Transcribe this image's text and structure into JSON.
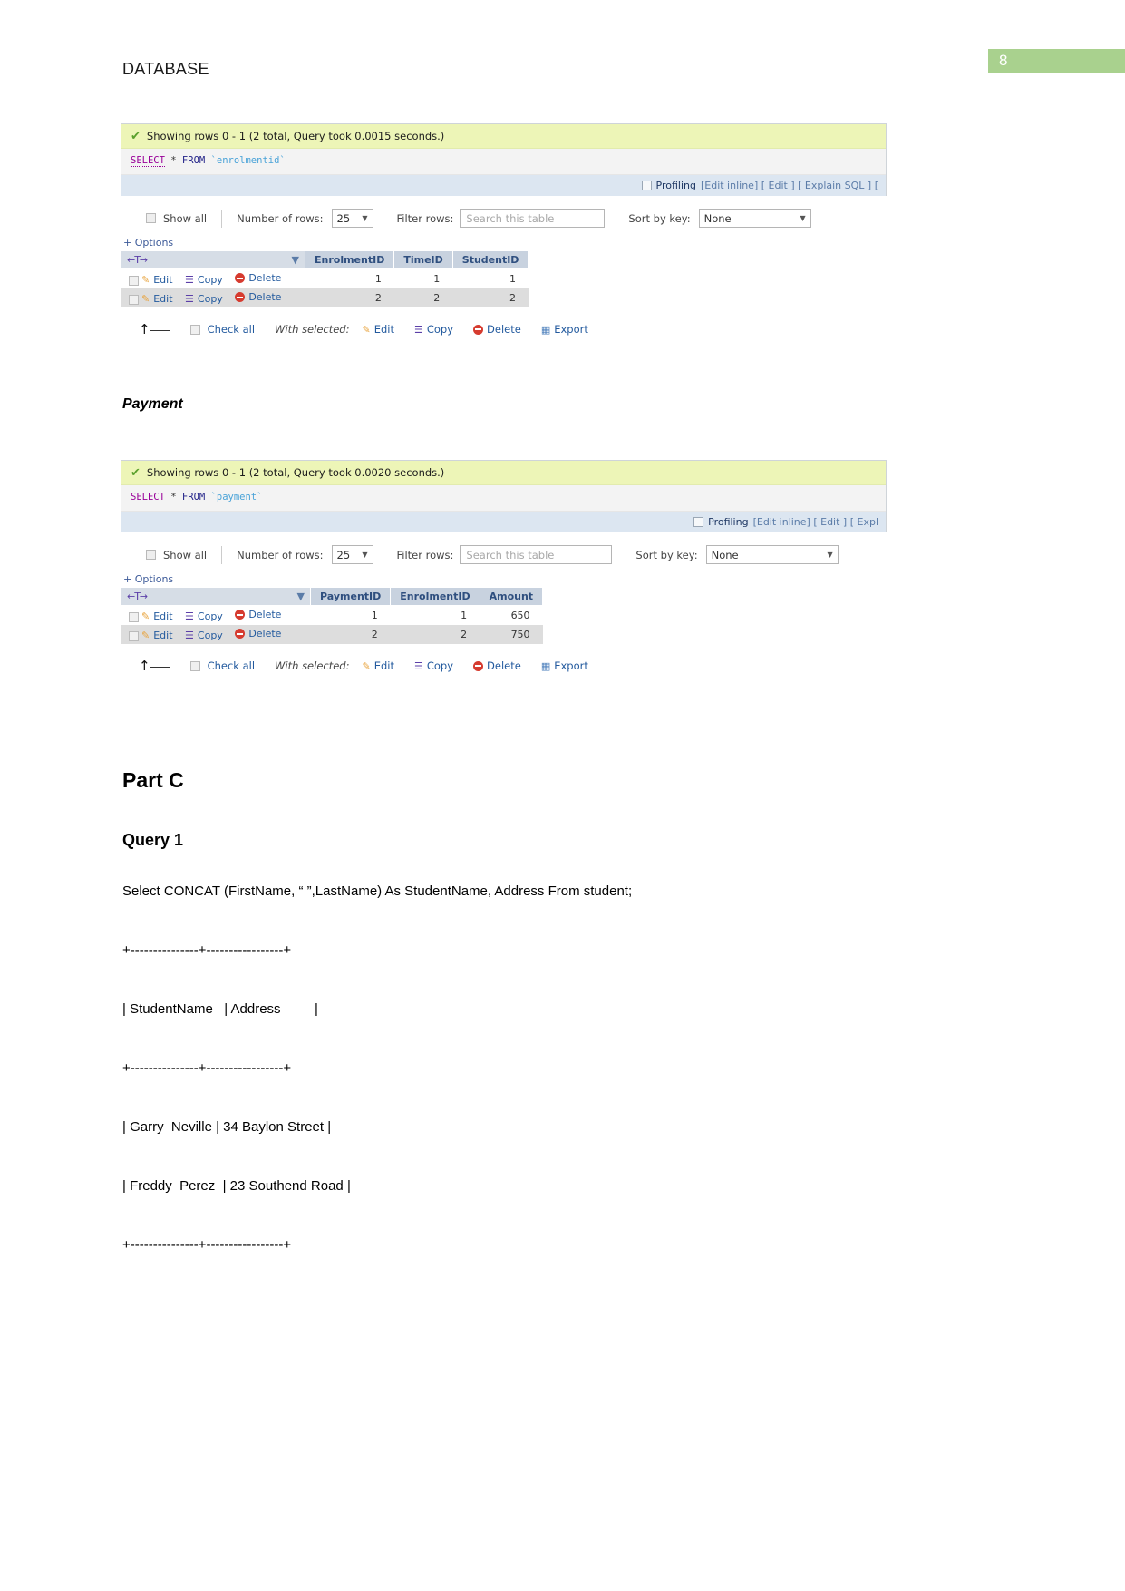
{
  "page": {
    "badge_number": "8",
    "badge_color": "#a9d18e",
    "heading": "DATABASE"
  },
  "results": [
    {
      "name": "enrolmentid",
      "status": "Showing rows 0 - 1 (2 total, Query took 0.0015 seconds.)",
      "sql": {
        "keyword": "SELECT",
        "star": "*",
        "from": "FROM",
        "table": "`enrolmentid`"
      },
      "profiling": {
        "label": "Profiling",
        "links": "[Edit inline] [ Edit ] [ Explain SQL ] ["
      },
      "toolbar": {
        "show_all": "Show all",
        "number_of_rows_label": "Number of rows:",
        "number_of_rows_value": "25",
        "filter_rows_label": "Filter rows:",
        "filter_rows_placeholder": "Search this table",
        "sort_by_key_label": "Sort by key:",
        "sort_by_key_value": "None"
      },
      "options_label": "+ Options",
      "actions": {
        "edit": "Edit",
        "copy": "Copy",
        "delete": "Delete",
        "export": "Export"
      },
      "columns": [
        "EnrolmentID",
        "TimeID",
        "StudentID"
      ],
      "rows": [
        [
          "1",
          "1",
          "1"
        ],
        [
          "2",
          "2",
          "2"
        ]
      ],
      "footer": {
        "check_all": "Check all",
        "with_selected": "With selected:"
      }
    },
    {
      "name": "payment",
      "status": "Showing rows 0 - 1 (2 total, Query took 0.0020 seconds.)",
      "sql": {
        "keyword": "SELECT",
        "star": "*",
        "from": "FROM",
        "table": "`payment`"
      },
      "profiling": {
        "label": "Profiling",
        "links": "[Edit inline] [ Edit ] [ Expl"
      },
      "toolbar": {
        "show_all": "Show all",
        "number_of_rows_label": "Number of rows:",
        "number_of_rows_value": "25",
        "filter_rows_label": "Filter rows:",
        "filter_rows_placeholder": "Search this table",
        "sort_by_key_label": "Sort by key:",
        "sort_by_key_value": "None"
      },
      "options_label": "+ Options",
      "actions": {
        "edit": "Edit",
        "copy": "Copy",
        "delete": "Delete",
        "export": "Export"
      },
      "columns": [
        "PaymentID",
        "EnrolmentID",
        "Amount"
      ],
      "rows": [
        [
          "1",
          "1",
          "650"
        ],
        [
          "2",
          "2",
          "750"
        ]
      ],
      "footer": {
        "check_all": "Check all",
        "with_selected": "With selected:"
      }
    }
  ],
  "sections": {
    "payment_heading": "Payment",
    "part_c": "Part C",
    "query_1": "Query 1",
    "query_1_sql": "Select CONCAT (FirstName, “ ”,LastName) As StudentName, Address From student;",
    "ascii_result": [
      "+---------------+-----------------+",
      "| StudentName   | Address         |",
      "+---------------+-----------------+",
      "| Garry  Neville | 34 Baylon Street |",
      "| Freddy  Perez  | 23 Southend Road |",
      "+---------------+-----------------+"
    ]
  }
}
